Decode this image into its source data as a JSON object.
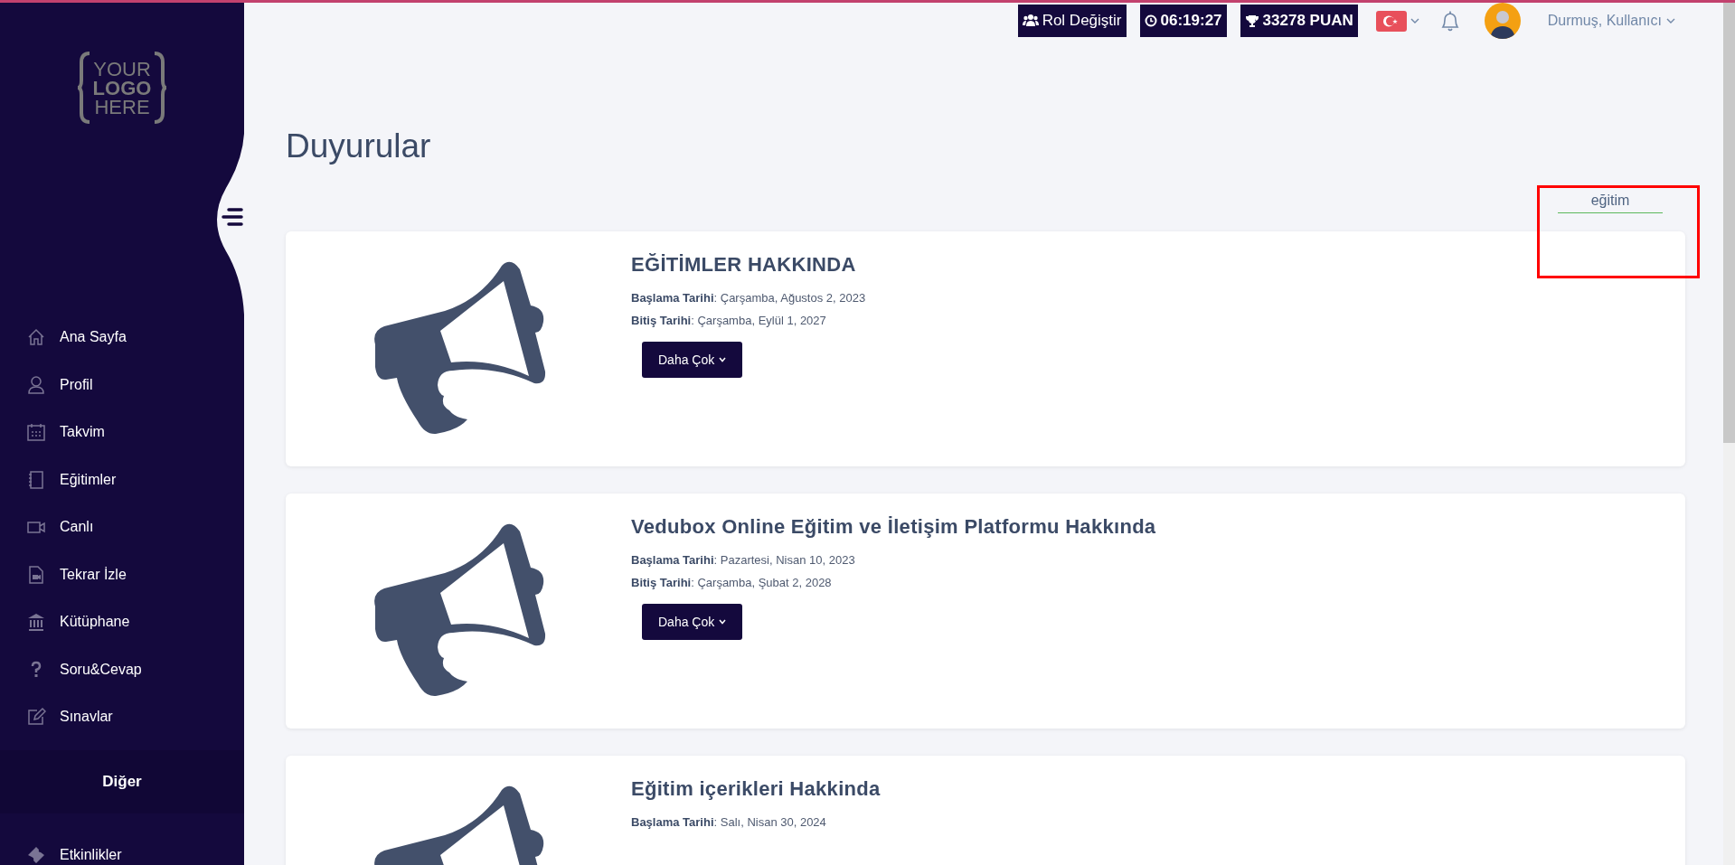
{
  "topbar": {
    "role_button": "Rol Değiştir",
    "timer": "06:19:27",
    "points": "33278 PUAN",
    "user_name": "Durmuş, Kullanıcı"
  },
  "sidebar": {
    "logo": [
      "YOUR",
      "LOGO",
      "HERE"
    ],
    "items": [
      {
        "label": "Ana Sayfa"
      },
      {
        "label": "Profil"
      },
      {
        "label": "Takvim"
      },
      {
        "label": "Eğitimler"
      },
      {
        "label": "Canlı"
      },
      {
        "label": "Tekrar İzle"
      },
      {
        "label": "Kütüphane"
      },
      {
        "label": "Soru&Cevap"
      },
      {
        "label": "Sınavlar"
      }
    ],
    "section_title": "Diğer",
    "section_items": [
      {
        "label": "Etkinlikler"
      }
    ]
  },
  "page_title": "Duyurular",
  "search": {
    "value": "eğitim"
  },
  "announcements": [
    {
      "title": "EĞİTİMLER HAKKINDA",
      "dates": [
        {
          "label": "Başlama Tarihi",
          "value": ": Çarşamba, Ağustos 2, 2023"
        },
        {
          "label": "Bitiş Tarihi",
          "value": ": Çarşamba, Eylül 1, 2027"
        }
      ],
      "button": "Daha Çok"
    },
    {
      "title": "Vedubox Online Eğitim ve İletişim Platformu Hakkında",
      "dates": [
        {
          "label": "Başlama Tarihi",
          "value": ": Pazartesi, Nisan 10, 2023"
        },
        {
          "label": "Bitiş Tarihi",
          "value": ": Çarşamba, Şubat 2, 2028"
        }
      ],
      "button": "Daha Çok"
    },
    {
      "title": "Eğitim içerikleri Hakkinda",
      "dates": [
        {
          "label": "Başlama Tarihi",
          "value": ": Salı, Nisan 30, 2024"
        }
      ]
    }
  ]
}
